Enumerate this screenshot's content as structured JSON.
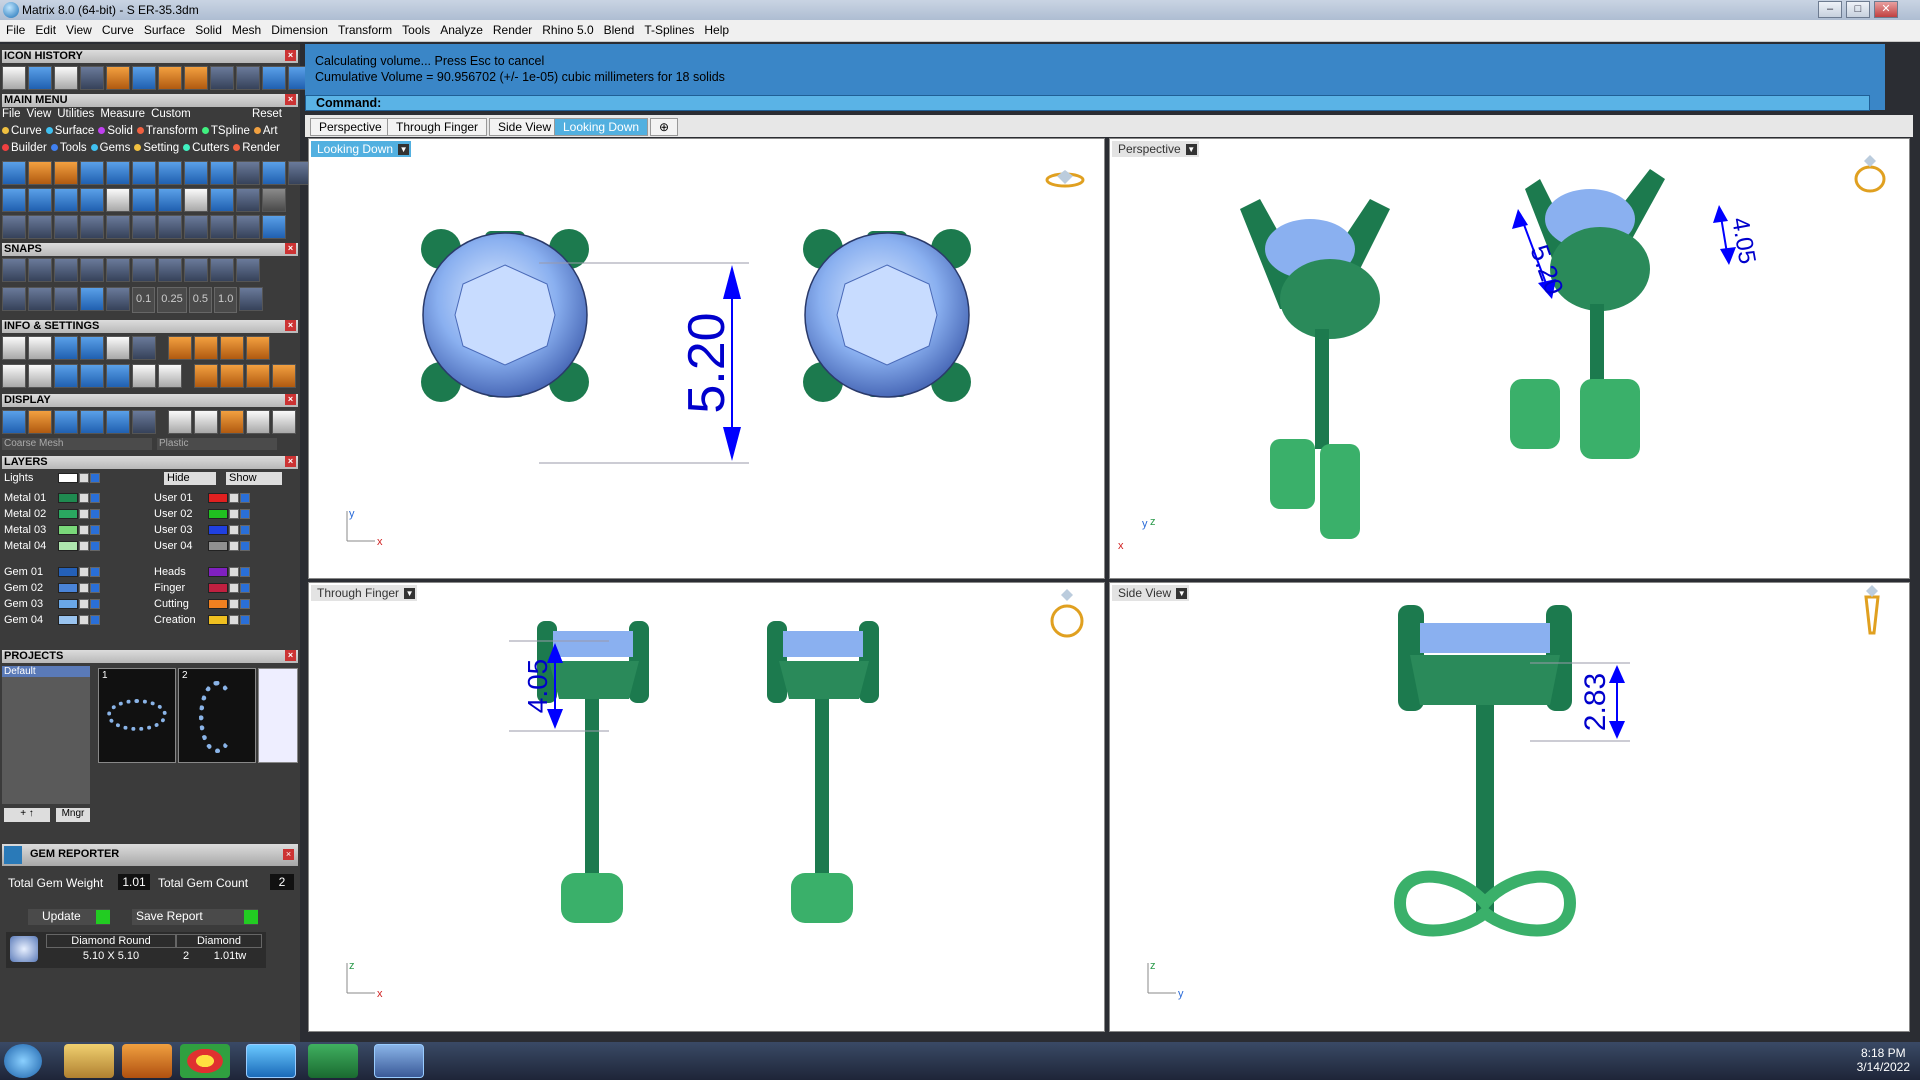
{
  "window": {
    "title": "Matrix 8.0 (64-bit) - S ER-35.3dm",
    "min": "–",
    "max": "□",
    "close": "✕"
  },
  "menubar": [
    "File",
    "Edit",
    "View",
    "Curve",
    "Surface",
    "Solid",
    "Mesh",
    "Dimension",
    "Transform",
    "Tools",
    "Analyze",
    "Render",
    "Rhino 5.0",
    "Blend",
    "T-Splines",
    "Help"
  ],
  "sections": {
    "icon_history": "ICON HISTORY",
    "main_menu": "MAIN MENU",
    "snaps": "SNAPS",
    "info_settings": "INFO & SETTINGS",
    "display": "DISPLAY",
    "layers": "LAYERS",
    "projects": "PROJECTS",
    "gem_reporter": "GEM REPORTER"
  },
  "main_menu_items": [
    "File",
    "View",
    "Utilities",
    "Measure",
    "Custom"
  ],
  "main_menu_reset": "Reset",
  "categories_row1": [
    {
      "label": "Curve",
      "color": "#f0c040"
    },
    {
      "label": "Surface",
      "color": "#40c0f0"
    },
    {
      "label": "Solid",
      "color": "#c040f0"
    },
    {
      "label": "Transform",
      "color": "#f06040"
    },
    {
      "label": "TSpline",
      "color": "#40f080"
    },
    {
      "label": "Art",
      "color": "#f0a040"
    }
  ],
  "categories_row2": [
    {
      "label": "Builder",
      "color": "#f04040"
    },
    {
      "label": "Tools",
      "color": "#4080f0"
    },
    {
      "label": "Gems",
      "color": "#40c0f0"
    },
    {
      "label": "Setting",
      "color": "#f0c040"
    },
    {
      "label": "Cutters",
      "color": "#40f0c0"
    },
    {
      "label": "Render",
      "color": "#f06040"
    }
  ],
  "snap_values": [
    "0.1",
    "0.25",
    "0.5",
    "1.0"
  ],
  "display": {
    "mesh": "Coarse Mesh",
    "material": "Plastic"
  },
  "layers": {
    "lights": "Lights",
    "hide": "Hide",
    "show": "Show",
    "left": [
      {
        "name": "Metal 01",
        "color": "#1f8a50"
      },
      {
        "name": "Metal 02",
        "color": "#2aa860"
      },
      {
        "name": "Metal 03",
        "color": "#7ad87a"
      },
      {
        "name": "Metal 04",
        "color": "#aee6ae"
      },
      {
        "name": "Gem 01",
        "color": "#2460b8"
      },
      {
        "name": "Gem 02",
        "color": "#4a84d8"
      },
      {
        "name": "Gem 03",
        "color": "#6aa8e8"
      },
      {
        "name": "Gem 04",
        "color": "#9ac4f0"
      }
    ],
    "right": [
      {
        "name": "User 01",
        "color": "#e02020"
      },
      {
        "name": "User 02",
        "color": "#20c020"
      },
      {
        "name": "User 03",
        "color": "#2040e0"
      },
      {
        "name": "User 04",
        "color": "#909090"
      },
      {
        "name": "Heads",
        "color": "#8020c0"
      },
      {
        "name": "Finger",
        "color": "#c02040"
      },
      {
        "name": "Cutting",
        "color": "#f08020"
      },
      {
        "name": "Creation",
        "color": "#f0c020"
      }
    ]
  },
  "projects": {
    "default": "Default",
    "thumb1": "1",
    "thumb2": "2",
    "mngr": "Mngr"
  },
  "gem_reporter": {
    "total_weight_label": "Total Gem Weight",
    "total_weight": "1.01",
    "total_count_label": "Total Gem Count",
    "total_count": "2",
    "update": "Update",
    "save_report": "Save Report",
    "table_headers": [
      "Diamond Round",
      "Diamond"
    ],
    "row": {
      "size": "5.10 X 5.10",
      "count": "2",
      "weight": "1.01tw"
    }
  },
  "command": {
    "line1": "Calculating volume... Press Esc to cancel",
    "line2": "Cumulative Volume = 90.956702 (+/- 1e-05) cubic millimeters for 18 solids",
    "prompt": "Command:"
  },
  "tabs": [
    {
      "label": "Perspective",
      "active": false
    },
    {
      "label": "Through Finger",
      "active": false
    },
    {
      "label": "Side View",
      "active": false
    },
    {
      "label": "Looking Down",
      "active": true
    }
  ],
  "add_tab": "⊕",
  "viewports": {
    "looking_down": {
      "label": "Looking Down",
      "dim": "5.20",
      "axis_y": "y",
      "axis_x": "x"
    },
    "perspective": {
      "label": "Perspective",
      "dim1": "5.20",
      "dim2": "4.05",
      "axis_y": "y",
      "axis_z": "z",
      "axis_x": "x"
    },
    "through_finger": {
      "label": "Through Finger",
      "dim": "4.05",
      "axis_z": "z",
      "axis_x": "x"
    },
    "side_view": {
      "label": "Side View",
      "dim": "2.83",
      "axis_z": "z",
      "axis_y": "y"
    }
  },
  "clock": {
    "time": "8:18 PM",
    "date": "3/14/2022"
  }
}
